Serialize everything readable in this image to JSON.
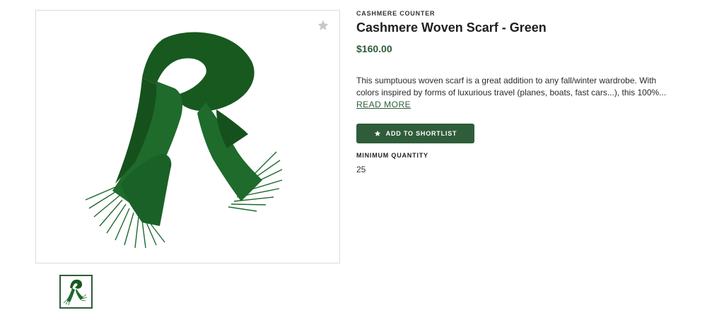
{
  "product": {
    "brand": "CASHMERE COUNTER",
    "title": "Cashmere Woven Scarf - Green",
    "price": "$160.00",
    "description": "This sumptuous woven scarf is a great addition to any fall/winter wardrobe. With colors inspired by forms of luxurious travel (planes, boats, fast cars...), this 100%...",
    "read_more_label": "READ MORE",
    "shortlist_label": "ADD TO SHORTLIST",
    "minimum_quantity_label": "MINIMUM QUANTITY",
    "minimum_quantity_value": "25"
  },
  "icons": {
    "favorite": "star-icon",
    "button": "star-icon"
  },
  "colors": {
    "accent": "#2f5d3a",
    "scarf": "#1e6b2c",
    "star_inactive": "#c8c8c8"
  }
}
